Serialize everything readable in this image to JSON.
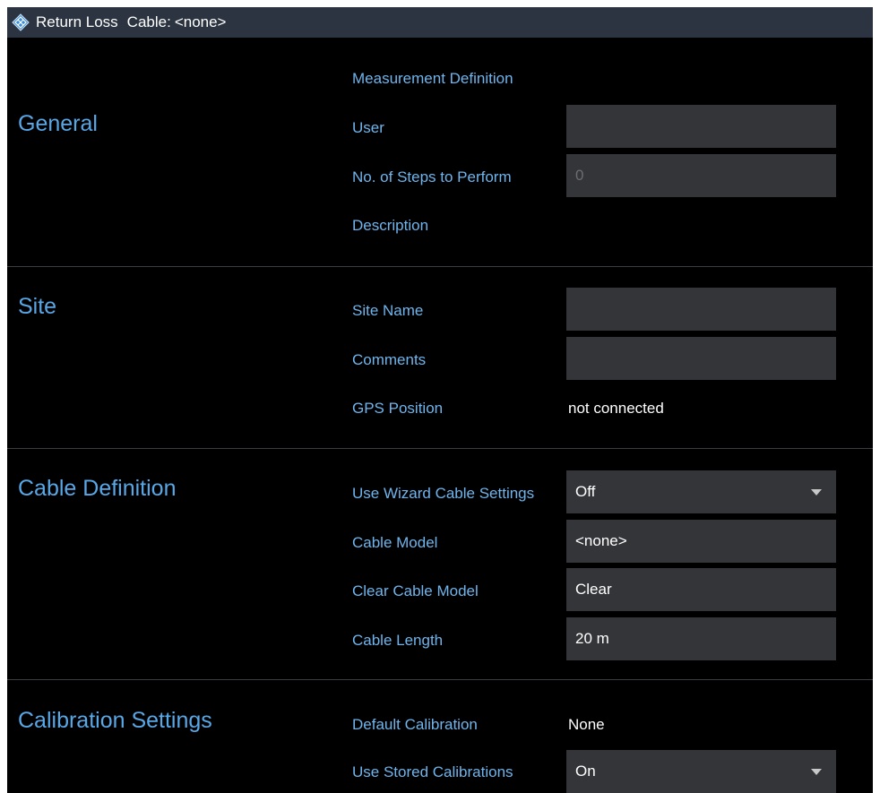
{
  "titlebar": {
    "title": "Return Loss",
    "cable_label": "Cable:",
    "cable_value": "<none>"
  },
  "general": {
    "heading": "General",
    "measurement_definition": "Measurement Definition",
    "user_label": "User",
    "user_value": "",
    "steps_label": "No. of Steps to Perform",
    "steps_value": "0",
    "description_label": "Description"
  },
  "site": {
    "heading": "Site",
    "site_name_label": "Site Name",
    "site_name_value": "",
    "comments_label": "Comments",
    "comments_value": "",
    "gps_label": "GPS Position",
    "gps_value": "not connected"
  },
  "cable": {
    "heading": "Cable Definition",
    "wizard_label": "Use Wizard Cable Settings",
    "wizard_value": "Off",
    "model_label": "Cable Model",
    "model_value": "<none>",
    "clear_label": "Clear Cable Model",
    "clear_value": "Clear",
    "length_label": "Cable Length",
    "length_value": "20 m"
  },
  "calibration": {
    "heading": "Calibration Settings",
    "default_label": "Default Calibration",
    "default_value": "None",
    "stored_label": "Use Stored Calibrations",
    "stored_value": "On"
  },
  "colors": {
    "heading": "#58a7e7",
    "label": "#6fb4ec",
    "field_bg": "#333539",
    "titlebar_bg": "#2b3440"
  },
  "icons": {
    "logo": "rohde-schwarz-diamond-icon",
    "dropdown": "triangle-down-icon"
  }
}
